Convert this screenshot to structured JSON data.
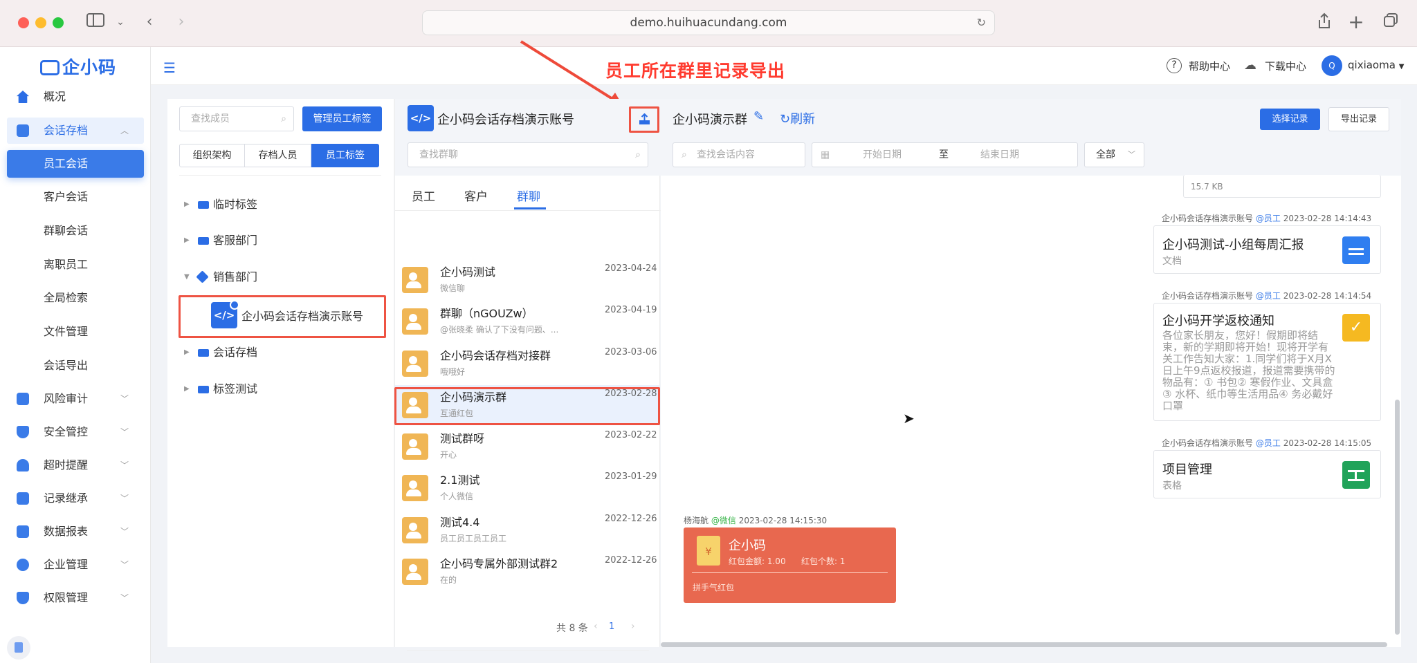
{
  "browser": {
    "url": "demo.huihuacundang.com"
  },
  "sidebar": {
    "logo": "企小码",
    "items": [
      {
        "label": "概况"
      },
      {
        "label": "会话存档"
      },
      {
        "label": "风险审计"
      },
      {
        "label": "安全管控"
      },
      {
        "label": "超时提醒"
      },
      {
        "label": "记录继承"
      },
      {
        "label": "数据报表"
      },
      {
        "label": "企业管理"
      },
      {
        "label": "权限管理"
      }
    ],
    "subitems": [
      "员工会话",
      "客户会话",
      "群聊会话",
      "离职员工",
      "全局检索",
      "文件管理",
      "会话导出"
    ]
  },
  "topbar": {
    "help": "帮助中心",
    "download": "下载中心",
    "user": "qixiaoma",
    "avatar": "Q"
  },
  "annotation": "员工所在群里记录导出",
  "left": {
    "search_placeholder": "查找成员",
    "manage_btn": "管理员工标签",
    "tabs": [
      "组织架构",
      "存档人员",
      "员工标签"
    ],
    "tree": [
      "临时标签",
      "客服部门",
      "销售部门",
      "企小码会话存档演示账号",
      "会话存档",
      "标签测试"
    ]
  },
  "middle": {
    "title": "企小码会话存档演示账号",
    "search_placeholder": "查找群聊",
    "tabs": [
      "员工",
      "客户",
      "群聊"
    ],
    "groups": [
      {
        "name": "企小码测试",
        "date": "2023-04-24",
        "sub": "微信聊"
      },
      {
        "name": "群聊（nGOUZw）",
        "date": "2023-04-19",
        "sub": "@张晓柔 确认了下没有问题、..."
      },
      {
        "name": "企小码会话存档对接群",
        "date": "2023-03-06",
        "sub": "哦哦好"
      },
      {
        "name": "企小码演示群",
        "date": "2023-02-28",
        "sub": "互通红包"
      },
      {
        "name": "测试群呀",
        "date": "2023-02-22",
        "sub": "开心"
      },
      {
        "name": "2.1测试",
        "date": "2023-01-29",
        "sub": "个人微信"
      },
      {
        "name": "测试4.4",
        "date": "2022-12-26",
        "sub": "员工员工员工员工"
      },
      {
        "name": "企小码专属外部测试群2",
        "date": "2022-12-26",
        "sub": "在的"
      }
    ],
    "total": "共 8 条",
    "page": "1"
  },
  "right": {
    "title": "企小码演示群",
    "refresh": "刷新",
    "select_btn": "选择记录",
    "export_btn": "导出记录",
    "search_placeholder": "查找会话内容",
    "start_date": "开始日期",
    "to": "至",
    "end_date": "结束日期",
    "filter": "全部",
    "file_size": "15.7 KB",
    "messages": [
      {
        "sender": "企小码会话存档演示账号",
        "tag": "@员工",
        "time": "2023-02-28 14:14:43",
        "title": "企小码测试-小组每周汇报",
        "sub": "文档",
        "color": "#2f7ef0"
      },
      {
        "sender": "企小码会话存档演示账号",
        "tag": "@员工",
        "time": "2023-02-28 14:14:54",
        "title": "企小码开学返校通知",
        "sub": "各位家长朋友，您好！假期即将结束，新的学期即将开始！现将开学有关工作告知大家：1.同学们将于X月X日上午9点返校报道，报道需要携带的物品有：① 书包② 寒假作业、文具盒③ 水杯、纸巾等生活用品④ 务必戴好口罩",
        "color": "#f5b921"
      },
      {
        "sender": "企小码会话存档演示账号",
        "tag": "@员工",
        "time": "2023-02-28 14:15:05",
        "title": "项目管理",
        "sub": "表格",
        "color": "#21a35a"
      }
    ],
    "redpacket": {
      "sender": "杨海航",
      "tag": "@微信",
      "time": "2023-02-28 14:15:30",
      "title": "企小码",
      "amount": "红包金额: 1.00",
      "count": "红包个数: 1",
      "type": "拼手气红包",
      "icon": "¥"
    }
  }
}
